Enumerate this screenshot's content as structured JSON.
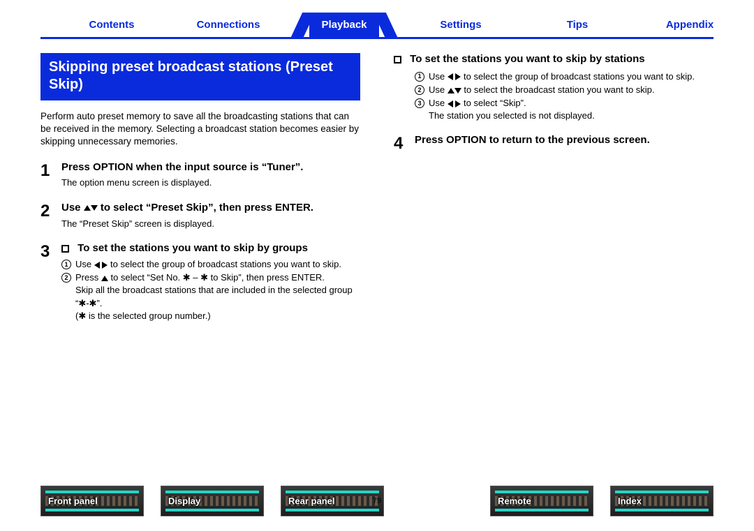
{
  "tabs": {
    "contents": "Contents",
    "connections": "Connections",
    "playback": "Playback",
    "settings": "Settings",
    "tips": "Tips",
    "appendix": "Appendix",
    "active": "playback"
  },
  "left": {
    "title": "Skipping preset broadcast stations (Preset Skip)",
    "intro": "Perform auto preset memory to save all the broadcasting stations that can be received in the memory. Selecting a broadcast station becomes easier by skipping unnecessary memories.",
    "step1": {
      "head": "Press OPTION when the input source is “Tuner”.",
      "sub": "The option menu screen is displayed."
    },
    "step2": {
      "head_pre": "Use ",
      "head_post": " to select “Preset Skip”, then press ENTER.",
      "sub": "The “Preset Skip” screen is displayed."
    },
    "step3": {
      "head": "To set the stations you want to skip by groups",
      "sub1_pre": "Use ",
      "sub1_post": " to select the group of broadcast stations you want to skip.",
      "sub2_pre": "Press ",
      "sub2_post": " to select “Set No. ✱ – ✱ to Skip”, then press ENTER.",
      "sub2_more": "Skip all the broadcast stations that are included in the selected group “✱-✱”.",
      "sub2_note": "(✱ is the selected group number.)"
    }
  },
  "right": {
    "groupHead": "To set the stations you want to skip by stations",
    "sub1_pre": "Use ",
    "sub1_post": " to select the group of broadcast stations you want to skip.",
    "sub2_pre": "Use ",
    "sub2_post": " to select the broadcast station you want to skip.",
    "sub3_pre": "Use ",
    "sub3_post": " to select “Skip”.",
    "sub3_more": "The station you selected is not displayed.",
    "step4": {
      "head": "Press OPTION to return to the previous screen."
    }
  },
  "footer": {
    "page": "79",
    "thumbs": {
      "front": "Front panel",
      "display": "Display",
      "rear": "Rear panel",
      "remote": "Remote",
      "index": "Index"
    }
  }
}
